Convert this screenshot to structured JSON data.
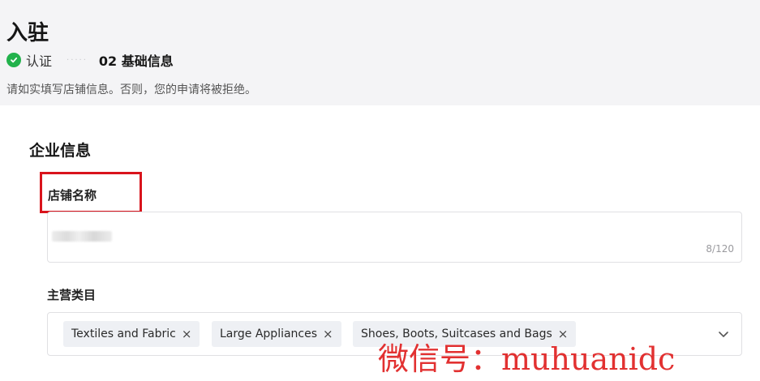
{
  "header": {
    "title": "入驻",
    "steps": [
      {
        "label": "认证",
        "status": "done"
      },
      {
        "label": "02 基础信息",
        "status": "current"
      }
    ],
    "step_dots": "·····",
    "instruction": "请如实填写店铺信息。否则，您的申请将被拒绝。"
  },
  "section": {
    "title": "企业信息",
    "store_name": {
      "label": "店铺名称",
      "char_count": "8/120"
    },
    "category": {
      "label": "主营类目",
      "tags": [
        {
          "label": "Textiles and Fabric",
          "remove": "×"
        },
        {
          "label": "Large Appliances",
          "remove": "×"
        },
        {
          "label": "Shoes, Boots, Suitcases and Bags",
          "remove": "×"
        }
      ]
    }
  },
  "watermark": "微信号：muhuanidc",
  "colors": {
    "success": "#22b24c",
    "highlight": "#d9141c",
    "header_bg": "#f4f4f6",
    "tag_bg": "#eef0f4",
    "watermark": "#e02020"
  },
  "icons": [
    "check-icon",
    "close-icon",
    "chevron-down-icon"
  ]
}
